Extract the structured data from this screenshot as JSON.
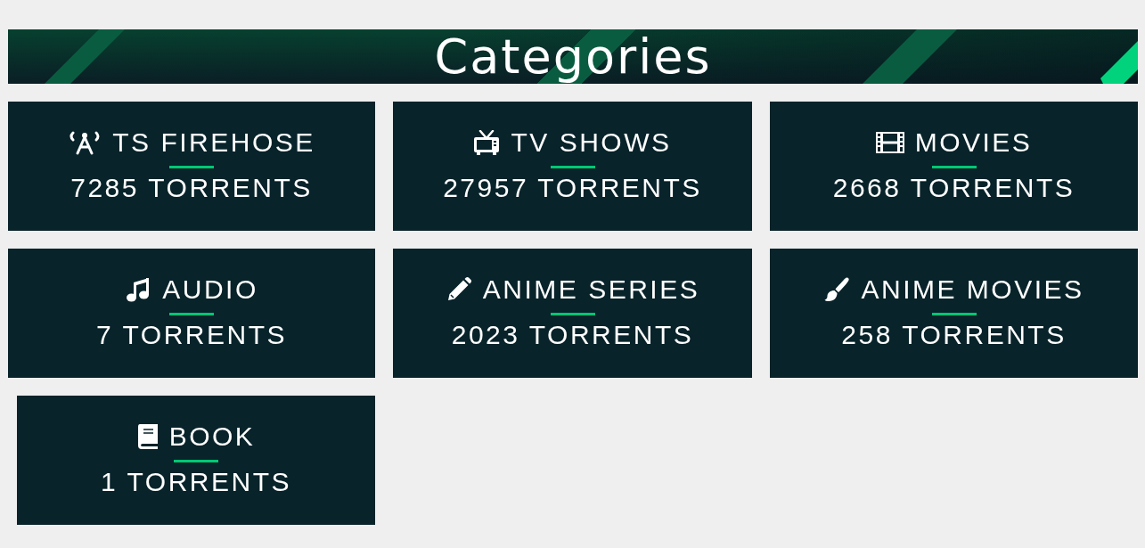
{
  "header": {
    "title": "Categories"
  },
  "categories": [
    {
      "name": "TS FIREHOSE",
      "count": "7285 TORRENTS"
    },
    {
      "name": "TV SHOWS",
      "count": "27957 TORRENTS"
    },
    {
      "name": "MOVIES",
      "count": "2668 TORRENTS"
    },
    {
      "name": "AUDIO",
      "count": "7 TORRENTS"
    },
    {
      "name": "ANIME SERIES",
      "count": "2023 TORRENTS"
    },
    {
      "name": "ANIME MOVIES",
      "count": "258 TORRENTS"
    },
    {
      "name": "BOOK",
      "count": "1 TORRENTS"
    }
  ]
}
